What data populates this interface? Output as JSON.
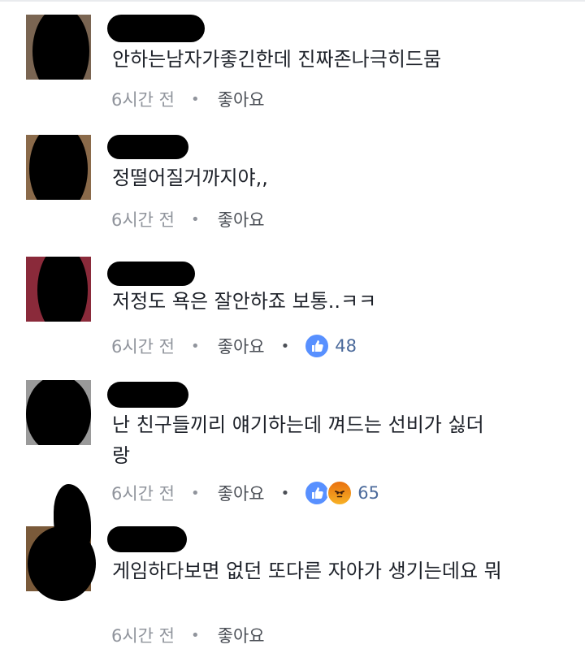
{
  "comments": [
    {
      "text": "안하는남자가좋긴한데 진짜존나극히드뭄",
      "time": "6시간 전",
      "like_label": "좋아요"
    },
    {
      "text": "정떨어질거까지야,,",
      "time": "6시간 전",
      "like_label": "좋아요"
    },
    {
      "text": "저정도 욕은 잘안하죠 보통..ㅋㅋ",
      "time": "6시간 전",
      "like_label": "좋아요",
      "reaction_count": "48"
    },
    {
      "text": "난 친구들끼리 얘기하는데 껴드는 선비가 싫더랑",
      "time": "6시간 전",
      "like_label": "좋아요",
      "reaction_count": "65"
    },
    {
      "text": "게임하다보면 없던 또다른 자아가 생기는데요 뭐",
      "time": "6시간 전",
      "like_label": "좋아요"
    }
  ],
  "icons": {
    "like": "thumbs-up-icon",
    "angry": "angry-face-icon"
  },
  "colors": {
    "like_blue": "#5890ff",
    "meta_gray": "#90949c",
    "text": "#1d2129"
  }
}
